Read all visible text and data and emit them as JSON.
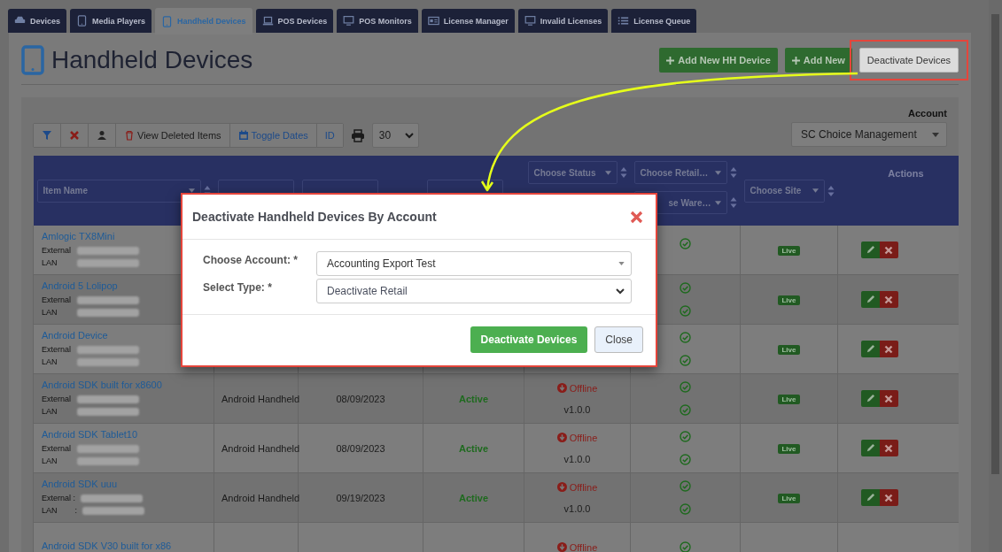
{
  "tabs": [
    {
      "label": "Devices",
      "selected": false
    },
    {
      "label": "Media Players",
      "selected": false
    },
    {
      "label": "Handheld Devices",
      "selected": true
    },
    {
      "label": "POS Devices",
      "selected": false
    },
    {
      "label": "POS Monitors",
      "selected": false
    },
    {
      "label": "License Manager",
      "selected": false
    },
    {
      "label": "Invalid Licenses",
      "selected": false
    },
    {
      "label": "License Queue",
      "selected": false
    }
  ],
  "page": {
    "title": "Handheld Devices"
  },
  "header_buttons": [
    {
      "label": "Add New HH Device",
      "kind": "add"
    },
    {
      "label": "Add New",
      "kind": "add"
    },
    {
      "label": "Deactivate Devices",
      "kind": "plain",
      "highlighted": true
    }
  ],
  "toolbar": {
    "buttons": [
      {
        "kind": "filter"
      },
      {
        "kind": "clear"
      },
      {
        "kind": "user"
      },
      {
        "kind": "trash",
        "label": "View Deleted Items"
      },
      {
        "kind": "calendar",
        "label": "Toggle Dates"
      },
      {
        "kind": "text",
        "label": "ID"
      }
    ],
    "page_size": "30"
  },
  "account": {
    "label": "Account",
    "value": "SC Choice Management"
  },
  "table": {
    "columns": [
      {
        "kind": "filter",
        "filters": [
          "Item Name"
        ]
      },
      {
        "kind": "blank"
      },
      {
        "kind": "blank"
      },
      {
        "kind": "blank"
      },
      {
        "kind": "stacked",
        "filters": [
          "Choose Status"
        ]
      },
      {
        "kind": "stacked",
        "filters": [
          "Choose Retail…",
          "se Ware…"
        ]
      },
      {
        "kind": "filter",
        "filters": [
          "Choose Site"
        ]
      },
      {
        "kind": "heading",
        "heading": "Actions"
      }
    ],
    "rows": [
      {
        "name": "Amlogic TX8Mini",
        "labels": [
          "External",
          "LAN"
        ],
        "checks": [
          true
        ],
        "badge": "Live",
        "actions": true
      },
      {
        "name": "Android 5 Lolipop",
        "labels": [
          "External",
          "LAN"
        ],
        "checks": [
          true,
          true
        ],
        "badge": "Live",
        "actions": true
      },
      {
        "name": "Android Device",
        "labels": [
          "External",
          "LAN"
        ],
        "checks": [
          true,
          true
        ],
        "badge": "Live",
        "actions": true
      },
      {
        "name": "Android SDK built for x8600",
        "labels": [
          "External",
          "LAN"
        ],
        "device_type": "Android Handheld",
        "date": "08/09/2023",
        "state": "Active",
        "status": {
          "label": "Offline",
          "kind": "offline"
        },
        "version": "v1.0.0",
        "checks": [
          true,
          true
        ],
        "badge": "Live",
        "actions": true
      },
      {
        "name": "Android SDK Tablet10",
        "labels": [
          "External",
          "LAN"
        ],
        "device_type": "Android Handheld",
        "date": "08/09/2023",
        "state": "Active",
        "status": {
          "label": "Offline",
          "kind": "offline"
        },
        "version": "v1.0.0",
        "checks": [
          true,
          true
        ],
        "badge": "Live",
        "actions": true
      },
      {
        "name": "Android SDK uuu",
        "labels": [
          "External :",
          "LAN        :"
        ],
        "device_type": "Android Handheld",
        "date": "09/19/2023",
        "state": "Active",
        "status": {
          "label": "Offline",
          "kind": "offline"
        },
        "version": "v1.0.0",
        "checks": [
          true,
          true
        ],
        "badge": "Live",
        "actions": true
      },
      {
        "name": "Android SDK V30 built for x86",
        "status": {
          "label": "Offline",
          "kind": "offline"
        },
        "checks": [
          true
        ]
      }
    ]
  },
  "modal": {
    "title": "Deactivate Handheld Devices By Account",
    "fields": [
      {
        "label": "Choose Account: *",
        "value": "Accounting Export Test",
        "kind": "combo"
      },
      {
        "label": "Select Type: *",
        "value": "Deactivate Retail",
        "kind": "select"
      }
    ],
    "buttons": [
      {
        "label": "Deactivate Devices",
        "kind": "primary"
      },
      {
        "label": "Close",
        "kind": "secondary"
      }
    ]
  }
}
